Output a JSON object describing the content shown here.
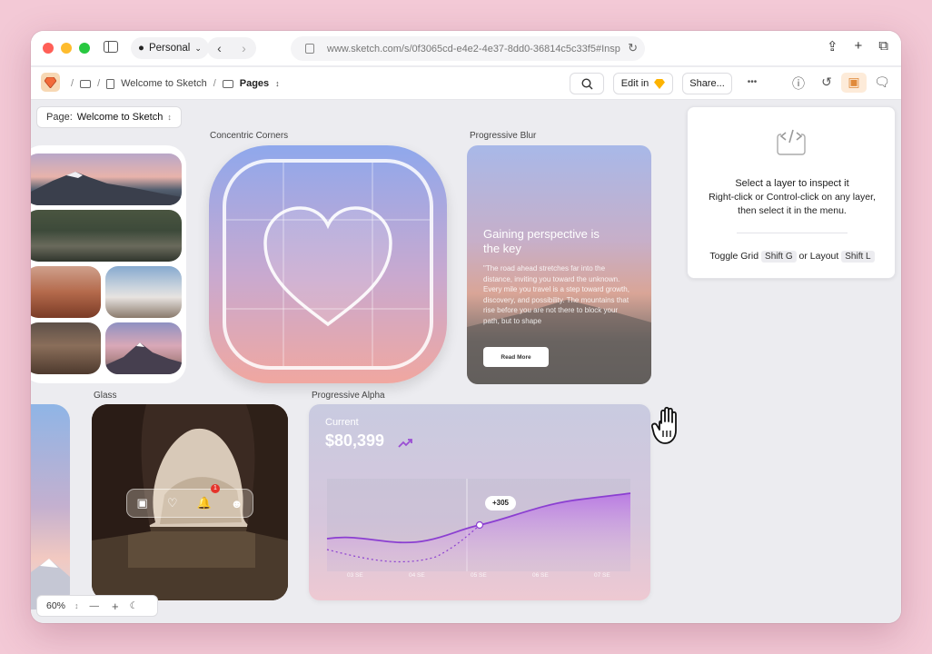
{
  "browser": {
    "profile_label": "Personal",
    "url": "www.sketch.com/s/0f3065cd-e4e2-4e37-8dd0-36814c5c33f5#Insp"
  },
  "appbar": {
    "breadcrumb_doc": "Welcome to Sketch",
    "breadcrumb_pages": "Pages",
    "edit_in_label": "Edit in",
    "share_label": "Share...",
    "more_label": "•••"
  },
  "canvas": {
    "page_select_prefix": "Page:",
    "page_select_value": "Welcome to Sketch",
    "labels": {
      "concentric": "Concentric Corners",
      "blur": "Progressive Blur",
      "glass": "Glass",
      "alpha": "Progressive Alpha"
    },
    "blur_card": {
      "title": "Gaining perspective is the key",
      "body": "\"The road ahead stretches far into the distance, inviting you toward the unknown. Every mile you travel is a step toward growth, discovery, and possibility. The mountains that rise before you are not there to block your path, but to shape",
      "button": "Read More"
    },
    "glass_card": {
      "badge": "1"
    },
    "alpha_card": {
      "label": "Current",
      "amount": "$80,399",
      "tooltip": "+305",
      "x_ticks": [
        "03 SE",
        "04 SE",
        "05 SE",
        "06 SE",
        "07 SE"
      ]
    }
  },
  "inspector": {
    "line1": "Select a layer to inspect it",
    "line2": "Right-click or Control-click on any layer,",
    "line3": "then select it in the menu.",
    "toggle_grid": "Toggle Grid",
    "grid_key": "Shift G",
    "or_layout": "or Layout",
    "layout_key": "Shift L"
  },
  "zoom": {
    "level": "60%"
  },
  "colors": {
    "background": "#f3c9d6",
    "accent_purple": "#9b4fd4",
    "badge_red": "#e5332a"
  }
}
